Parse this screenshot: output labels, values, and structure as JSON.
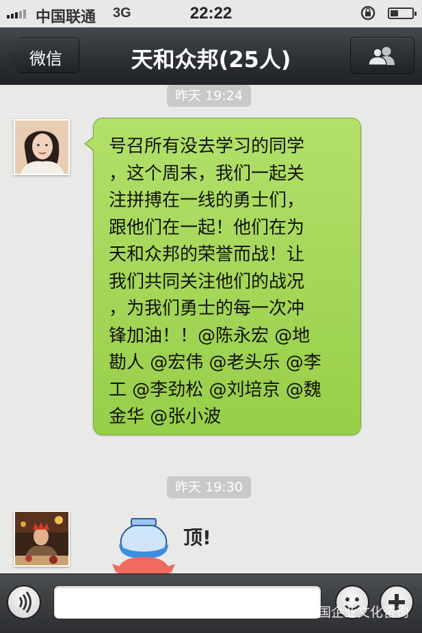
{
  "status_bar": {
    "carrier": "中国联通",
    "network": "3G",
    "time": "22:22"
  },
  "nav": {
    "back_label": "微信",
    "title": "天和众邦(25人)",
    "members_icon": "group-icon"
  },
  "messages": [
    {
      "timestamp": "昨天 19:24",
      "lines": [
        "号召所有没去学习的同学",
        "，这个周末，我们一起关",
        "注拼搏在一线的勇士们，",
        "跟他们在一起！他们在为",
        "天和众邦的荣誉而战！让",
        "我们共同关注他们的战况",
        "，为我们勇士的每一次冲",
        "锋加油！！@陈永宏 @地",
        "勘人 @宏伟 @老头乐 @李",
        "工 @李劲松 @刘培京 @魏",
        "金华 @张小波"
      ]
    },
    {
      "timestamp": "昨天 19:30",
      "sticker_text": "顶!"
    }
  ],
  "input_bar": {
    "voice_icon": "voice-icon",
    "emoji_icon": "emoji-icon",
    "plus_icon": "plus-icon"
  },
  "watermark": "中国企业文化咨询",
  "colors": {
    "bubble_green": "#a8db5e",
    "nav_dark": "#2d3034"
  }
}
